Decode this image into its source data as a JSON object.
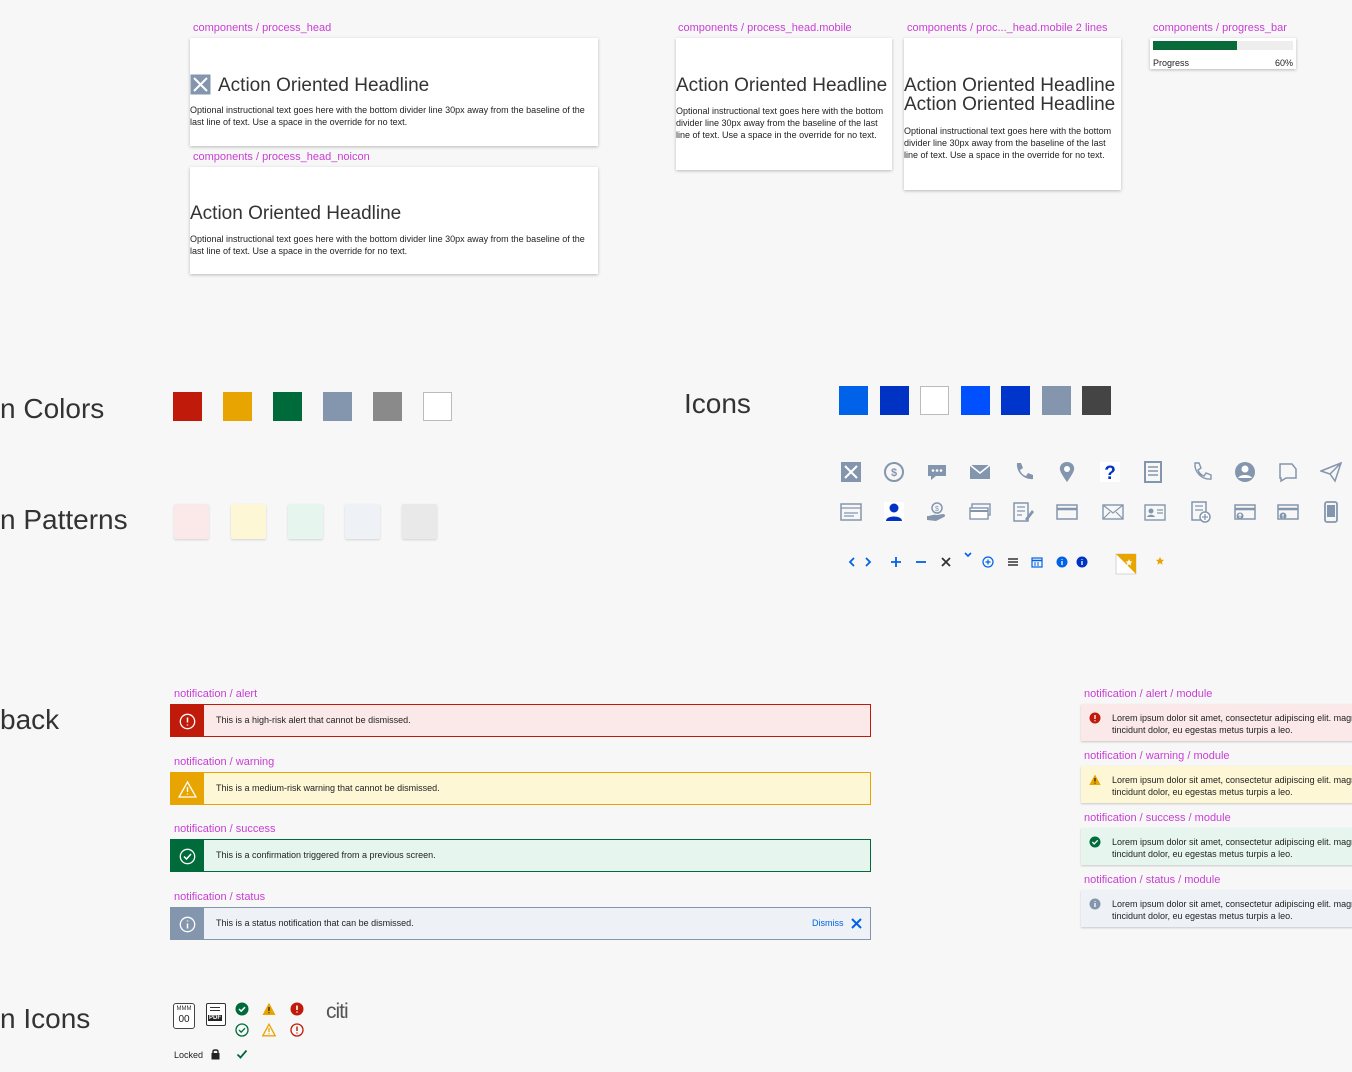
{
  "components": {
    "process_head": {
      "label": "components / process_head",
      "headline": "Action Oriented Headline",
      "text": "Optional instructional text goes here with the bottom divider line 30px away from the baseline of the last line of text. Use a space in the override for no text."
    },
    "process_head_noicon": {
      "label": "components / process_head_noicon",
      "headline": "Action Oriented Headline",
      "text": "Optional instructional text goes here with the bottom divider line 30px away from the baseline of the last line of text. Use a space in the override for no text."
    },
    "process_head_mobile": {
      "label": "components / process_head.mobile",
      "headline": "Action Oriented Headline",
      "text": "Optional instructional text goes here with the bottom divider line 30px away from the baseline of the last line of text. Use a space in the override for no text."
    },
    "process_head_mobile_2lines": {
      "label": "components / proc..._head.mobile 2 lines",
      "headline_1": "Action Oriented Headline",
      "headline_2": "Action Oriented Headline",
      "text": "Optional instructional text goes here with the bottom divider line 30px away from the baseline of the last line of text. Use a space in the override for no text."
    },
    "progress_bar": {
      "label": "components / progress_bar",
      "caption": "Progress",
      "value_text": "60%",
      "value": 0.6,
      "fill_color": "#0a6b3a"
    }
  },
  "sections": {
    "colors": "n Colors",
    "patterns": "n Patterns",
    "icons": "Icons",
    "feedback": "back",
    "status_icons": "n Icons"
  },
  "color_swatches": [
    "#c01a0a",
    "#e8a400",
    "#006b3a",
    "#8496ae",
    "#8a8a8a",
    "#ffffff"
  ],
  "pattern_swatches": [
    "#fbe9ea",
    "#fef7d6",
    "#e6f6ef",
    "#eef2f6",
    "#e9e9e9"
  ],
  "icon_swatches": [
    "#0062e8",
    "#0033c4",
    "#ffffff",
    "#0050ff",
    "#0035cc",
    "#8496ae",
    "#444444"
  ],
  "icon_grid": {
    "color": "#8496ae",
    "row1": [
      "broken-image-icon",
      "refresh-money-icon",
      "chat-bubbles-icon",
      "envelope-icon",
      "phone-icon",
      "location-pin-icon",
      "help-question-icon",
      "document-list-icon",
      "phone-outline-icon",
      "user-circle-icon",
      "chat-outline-icon",
      "paper-plane-icon"
    ],
    "row2": [
      "check-image-icon",
      "user-person-icon",
      "hand-money-icon",
      "card-stack-icon",
      "document-edit-icon",
      "credit-card-icon",
      "envelope-outline-icon",
      "id-card-icon",
      "document-add-icon",
      "card-up-icon",
      "card-alert-icon",
      "mobile-phone-icon"
    ]
  },
  "small_icons": [
    "chevron-left-icon",
    "chevron-right-icon",
    "plus-icon",
    "minus-icon",
    "close-x-icon",
    "caret-down-icon",
    "add-circle-icon",
    "menu-lines-icon",
    "calendar-icon",
    "info-filled-icon",
    "info-filled-dark-icon",
    "note-star-icon",
    "star-icon"
  ],
  "notifications": [
    {
      "label": "notification / alert",
      "text": "This is a high-risk alert that cannot be dismissed.",
      "accent": "#c01a0a",
      "bg": "#fbe9ea",
      "icon": "alert-circle-icon"
    },
    {
      "label": "notification / warning",
      "text": "This is a medium-risk warning that cannot be dismissed.",
      "accent": "#e8a400",
      "bg": "#fef7d6",
      "icon": "warning-triangle-icon"
    },
    {
      "label": "notification / success",
      "text": "This is a confirmation triggered from a previous screen.",
      "accent": "#006b3a",
      "bg": "#e6f6ef",
      "icon": "check-circle-icon"
    },
    {
      "label": "notification / status",
      "text": "This is a status notification that can be dismissed.",
      "accent": "#8496ae",
      "bg": "#eef2f6",
      "icon": "info-circle-icon",
      "dismiss": "Dismiss"
    }
  ],
  "module_notifications": [
    {
      "label": "notification / alert / module",
      "text": "Lorem ipsum dolor sit amet, consectetur adipiscing elit. magna tincidunt dolor, eu egestas metus turpis a leo.",
      "accent": "#c01a0a",
      "bg": "#fbe9ea",
      "icon": "alert-filled-icon"
    },
    {
      "label": "notification / warning / module",
      "text": "Lorem ipsum dolor sit amet, consectetur adipiscing elit. magna tincidunt dolor, eu egestas metus turpis a leo.",
      "accent": "#e8a400",
      "bg": "#fef7d6",
      "icon": "warning-filled-icon"
    },
    {
      "label": "notification / success / module",
      "text": "Lorem ipsum dolor sit amet, consectetur adipiscing elit. magna tincidunt dolor, eu egestas metus turpis a leo.",
      "accent": "#006b3a",
      "bg": "#e6f6ef",
      "icon": "check-filled-icon"
    },
    {
      "label": "notification / status / module",
      "text": "Lorem ipsum dolor sit amet, consectetur adipiscing elit. magna tincidunt dolor, eu egestas metus turpis a leo.",
      "accent": "#8496ae",
      "bg": "#eef2f6",
      "icon": "info-filled-icon"
    }
  ],
  "status_icons": {
    "date_month": "MMM",
    "date_day": "00",
    "pdf_text": "PDF",
    "locked_label": "Locked",
    "logo_text": "citi"
  }
}
